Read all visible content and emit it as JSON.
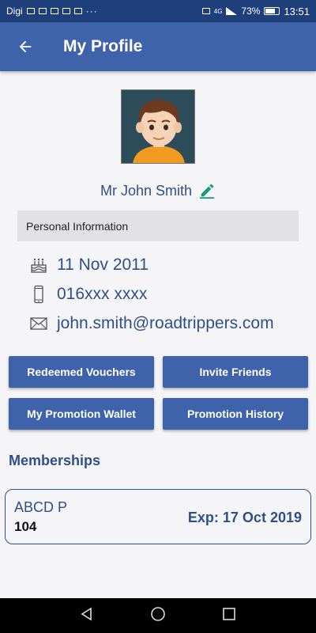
{
  "status_bar": {
    "carrier": "Digi",
    "more": "···",
    "network": "4G",
    "battery_pct": "73%",
    "time": "13:51"
  },
  "app_bar": {
    "title": "My Profile",
    "back_icon": "arrow-left-icon"
  },
  "profile": {
    "name": "Mr John Smith",
    "edit_icon": "pencil-icon",
    "section_title": "Personal Information",
    "birthday": "11 Nov 2011",
    "phone": "016xxx xxxx",
    "email": "john.smith@roadtrippers.com"
  },
  "actions": {
    "redeemed_vouchers": "Redeemed Vouchers",
    "invite_friends": "Invite Friends",
    "promotion_wallet": "My Promotion Wallet",
    "promotion_history": "Promotion History"
  },
  "memberships": {
    "title": "Memberships",
    "items": [
      {
        "name": "ABCD P",
        "id": "104",
        "expiry": "Exp: 17 Oct 2019"
      }
    ]
  },
  "colors": {
    "status_bar": "#1e3f7a",
    "app_bar": "#3e63aa",
    "primary_text": "#2e4f88",
    "edit_icon": "#1a9a80"
  }
}
